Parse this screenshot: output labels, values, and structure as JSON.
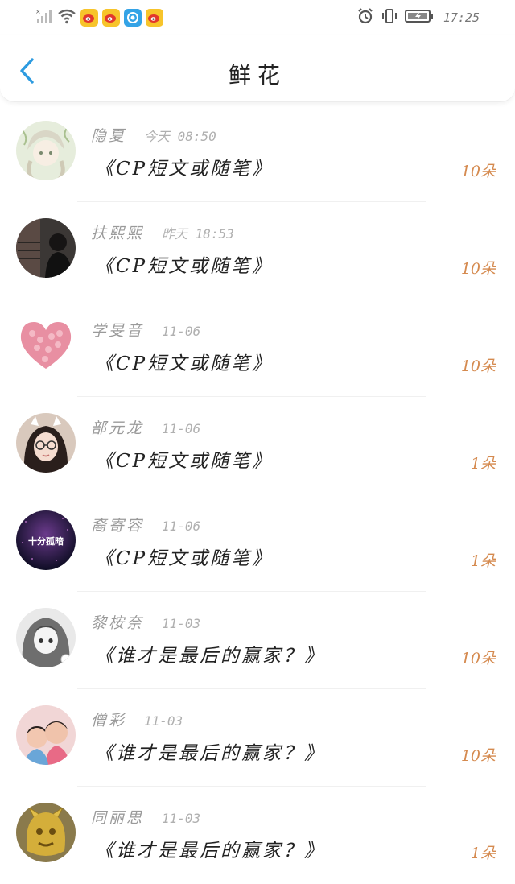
{
  "status_bar": {
    "time": "17:25",
    "icons": [
      "signal-icon",
      "wifi-icon",
      "weibo-icon",
      "weibo-icon",
      "browser-icon",
      "weibo-icon",
      "alarm-icon",
      "vibrate-icon",
      "battery-icon"
    ]
  },
  "nav": {
    "title": "鲜花"
  },
  "colors": {
    "accent": "#2d9be0",
    "count": "#d58a4f"
  },
  "records": [
    {
      "name": "隐夏",
      "time": "今天 08:50",
      "title": "《CP短文或随笔》",
      "count": "10朵"
    },
    {
      "name": "扶熙熙",
      "time": "昨天 18:53",
      "title": "《CP短文或随笔》",
      "count": "10朵"
    },
    {
      "name": "学旻音",
      "time": "11-06",
      "title": "《CP短文或随笔》",
      "count": "10朵"
    },
    {
      "name": "部元龙",
      "time": "11-06",
      "title": "《CP短文或随笔》",
      "count": "1朵"
    },
    {
      "name": "裔寄容",
      "time": "11-06",
      "title": "《CP短文或随笔》",
      "count": "1朵"
    },
    {
      "name": "黎桉奈",
      "time": "11-03",
      "title": "《谁才是最后的赢家？》",
      "count": "10朵"
    },
    {
      "name": "僧彩",
      "time": "11-03",
      "title": "《谁才是最后的赢家？》",
      "count": "10朵"
    },
    {
      "name": "同丽思",
      "time": "11-03",
      "title": "《谁才是最后的赢家？》",
      "count": "1朵"
    }
  ],
  "avatar_caption": "十分孤暗"
}
